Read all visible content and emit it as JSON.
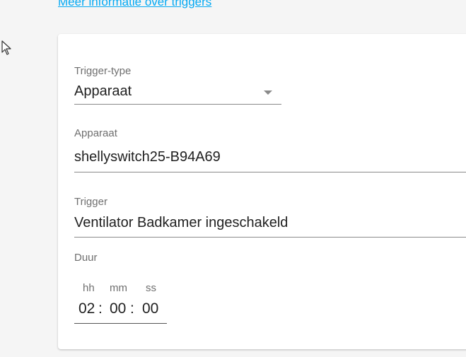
{
  "link": {
    "more_info": "Meer informatie over triggers"
  },
  "cursor": {
    "icon": "mouse-pointer-icon"
  },
  "trigger_type": {
    "label": "Trigger-type",
    "value": "Apparaat",
    "icon": "dropdown-arrow-icon"
  },
  "device": {
    "label": "Apparaat",
    "value": "shellyswitch25-B94A69"
  },
  "trigger": {
    "label": "Trigger",
    "value": "Ventilator Badkamer ingeschakeld"
  },
  "duration": {
    "label": "Duur",
    "hours_label": "hh",
    "minutes_label": "mm",
    "seconds_label": "ss",
    "hours": "02",
    "minutes": "00",
    "seconds": "00",
    "separator": ":"
  },
  "colors": {
    "link": "#03a9f4",
    "label": "#6f6f6f",
    "text": "#212121",
    "card": "#ffffff",
    "background": "#f5f5f5"
  }
}
